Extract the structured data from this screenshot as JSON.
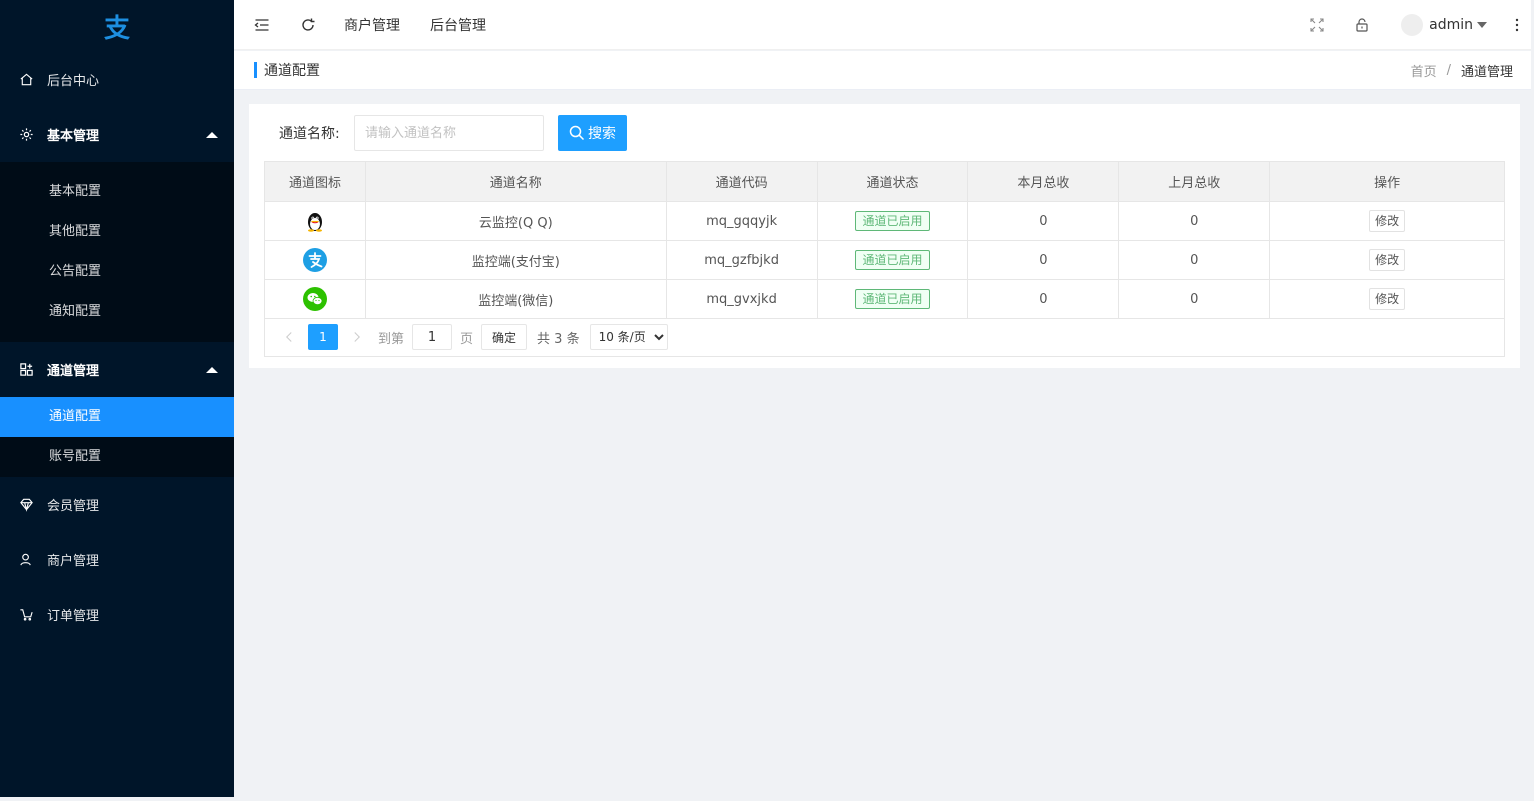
{
  "logo": {
    "glyph": "支"
  },
  "sidebar": {
    "home": "后台中心",
    "basic": {
      "label": "基本管理",
      "items": [
        "基本配置",
        "其他配置",
        "公告配置",
        "通知配置"
      ]
    },
    "channel": {
      "label": "通道管理",
      "items": [
        "通道配置",
        "账号配置"
      ]
    },
    "member": "会员管理",
    "merchant": "商户管理",
    "order": "订单管理"
  },
  "header": {
    "links": [
      "商户管理",
      "后台管理"
    ],
    "user": "admin"
  },
  "titlebar": {
    "title": "通道配置",
    "breadcrumb": {
      "home": "首页",
      "sep": "/",
      "current": "通道管理"
    }
  },
  "search": {
    "label": "通道名称:",
    "placeholder": "请输入通道名称",
    "button": "搜索"
  },
  "table": {
    "headers": [
      "通道图标",
      "通道名称",
      "通道代码",
      "通道状态",
      "本月总收",
      "上月总收",
      "操作"
    ],
    "rows": [
      {
        "icon": "qq-icon",
        "name": "云监控(Q Q)",
        "code": "mq_gqqyjk",
        "status": "通道已启用",
        "this_month": "0",
        "last_month": "0",
        "action": "修改"
      },
      {
        "icon": "alipay-icon",
        "name": "监控端(支付宝)",
        "code": "mq_gzfbjkd",
        "status": "通道已启用",
        "this_month": "0",
        "last_month": "0",
        "action": "修改"
      },
      {
        "icon": "wechat-icon",
        "name": "监控端(微信)",
        "code": "mq_gvxjkd",
        "status": "通道已启用",
        "this_month": "0",
        "last_month": "0",
        "action": "修改"
      }
    ]
  },
  "pager": {
    "current": "1",
    "goto_label": "到第",
    "goto_value": "1",
    "page_unit": "页",
    "confirm": "确定",
    "total": "共 3 条",
    "page_size": "10 条/页"
  },
  "colors": {
    "sidebar_bg": "#001529",
    "active": "#1890ff",
    "primary_btn": "#1e9fff",
    "status_green": "#5fb878"
  }
}
